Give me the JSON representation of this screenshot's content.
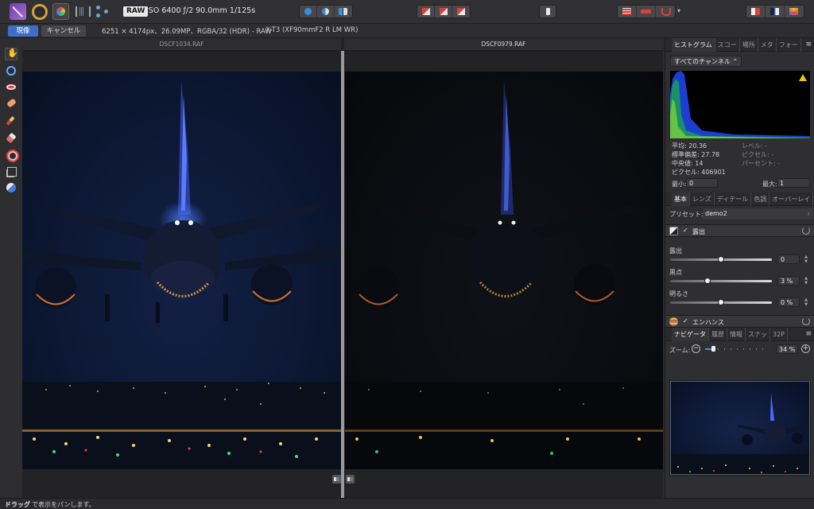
{
  "toolbar": {
    "raw_badge": "RAW",
    "exif": "ISO 6400 ƒ/2 90.0mm 1/125s",
    "personas": [
      "photo-persona-icon",
      "liquify-persona-icon",
      "develop-persona-icon",
      "tone-mapping-persona-icon",
      "export-persona-icon"
    ],
    "overlay_dropdown_arrow": "▾"
  },
  "context": {
    "develop_label": "現像",
    "cancel_label": "キャンセル",
    "image_info": "6251 × 4174px、26.09MP、RGBA/32 (HDR) - RAW",
    "camera_info": "X-T3 (XF90mmF2 R LM WR)"
  },
  "canvas": {
    "left_file": "DSCF1034.RAF",
    "right_file": "DSCF0979.RAF"
  },
  "histogram_panel": {
    "tabs": [
      "ヒストグラム",
      "スコー",
      "場所",
      "メタ",
      "フォー"
    ],
    "menu": "≡",
    "channel": "すべてのチャンネル ⌃",
    "stats": {
      "mean": "平均: 20.36",
      "stddev": "標準偏差: 27.78",
      "median": "中央値: 14",
      "pixels": "ピクセル: 406901",
      "level": "レベル: -",
      "pixel_dim": "ピクセル: -",
      "percent": "パーセント: -"
    },
    "min_label": "最小:",
    "min_value": "0",
    "max_label": "最大:",
    "max_value": "1"
  },
  "basic_panel": {
    "tabs": [
      "基本",
      "レンズ",
      "ディテール",
      "色調",
      "オーバーレイ"
    ],
    "preset_label": "プリセット:",
    "preset_value": "demo2",
    "exposure_section": {
      "check": "✓",
      "title": "露出",
      "sliders": [
        {
          "label": "露出",
          "value": "0",
          "position": 0.5
        },
        {
          "label": "黒点",
          "value": "3 %",
          "position": 0.37
        },
        {
          "label": "明るさ",
          "value": "0 %",
          "position": 0.5
        }
      ]
    },
    "enhance_section": {
      "check": "✓",
      "title": "エンハンス"
    }
  },
  "navigator_panel": {
    "tabs": [
      "ナビゲータ",
      "履歴",
      "情報",
      "スナッ",
      "32P"
    ],
    "menu": "≡",
    "zoom_label": "ズーム:",
    "zoom_minus": "−",
    "zoom_plus": "+",
    "zoom_value": "34 %",
    "zoom_position": 0.12
  },
  "status": {
    "strong": "ドラッグ",
    "rest": "で表示をパンします。"
  }
}
